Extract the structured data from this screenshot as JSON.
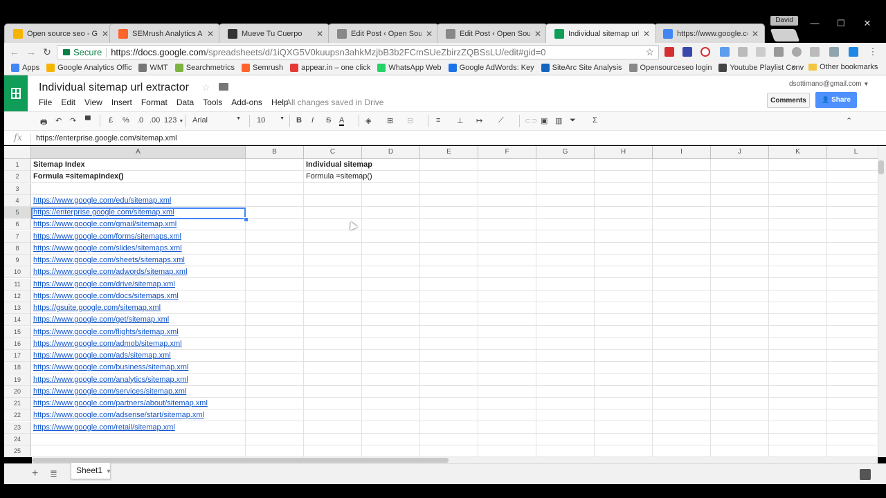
{
  "browser": {
    "tabs": [
      {
        "label": "Open source seo - Goo",
        "favicon": "drive-icon",
        "color": "#f4b400",
        "active": false
      },
      {
        "label": "SEMrush Analytics API |",
        "favicon": "semrush-icon",
        "color": "#ff642d",
        "active": false
      },
      {
        "label": "Mueve Tu Cuerpo",
        "favicon": "spotify-icon",
        "color": "#333333",
        "active": false
      },
      {
        "label": "Edit Post ‹ Open Source",
        "favicon": "page-icon",
        "color": "#888888",
        "active": false
      },
      {
        "label": "Edit Post ‹ Open Source",
        "favicon": "page-icon",
        "color": "#888888",
        "active": false
      },
      {
        "label": "Individual sitemap url e",
        "favicon": "sheets-icon",
        "color": "#0f9d58",
        "active": true
      },
      {
        "label": "https://www.google.co",
        "favicon": "google-icon",
        "color": "#4285f4",
        "active": false
      }
    ],
    "profile_name": "David",
    "address": {
      "secure_label": "Secure",
      "url_host": "https://docs.google.com",
      "url_path": "/spreadsheets/d/1iQXG5V0kuupsn3ahkMzjbB3b2FCmSUeZbirzZQBSsLU/edit#gid=0"
    },
    "bookmarks": [
      {
        "label": "Apps",
        "color": "#4285f4"
      },
      {
        "label": "Google Analytics Offic",
        "color": "#f4b400"
      },
      {
        "label": "WMT",
        "color": "#777777"
      },
      {
        "label": "Searchmetrics",
        "color": "#7cb342"
      },
      {
        "label": "Semrush",
        "color": "#ff642d"
      },
      {
        "label": "appear.in – one click",
        "color": "#e53935"
      },
      {
        "label": "WhatsApp Web",
        "color": "#25d366"
      },
      {
        "label": "Google AdWords: Key",
        "color": "#1a73e8"
      },
      {
        "label": "SiteArc Site Analysis",
        "color": "#1565c0"
      },
      {
        "label": "Opensourceseo login",
        "color": "#888888"
      },
      {
        "label": "Youtube Playlist Conv",
        "color": "#444444"
      }
    ],
    "bookmarks_more": "»",
    "other_bookmarks": "Other bookmarks"
  },
  "sheets": {
    "title": "Individual sitemap url extractor",
    "menu": [
      "File",
      "Edit",
      "View",
      "Insert",
      "Format",
      "Data",
      "Tools",
      "Add-ons",
      "Help"
    ],
    "save_status": "All changes saved in Drive",
    "account": "dsottimano@gmail.com",
    "comments_label": "Comments",
    "share_label": "Share",
    "toolbar": {
      "currency": "£",
      "percent": "%",
      "dec_less": ".0",
      "dec_more": ".00",
      "format_more": "123",
      "font": "Arial",
      "font_size": "10",
      "bold": "B",
      "italic": "I",
      "strike": "S",
      "text_color": "A",
      "functions": "Σ"
    },
    "formula_bar": {
      "fx": "fx",
      "value": "https://enterprise.google.com/sitemap.xml"
    },
    "columns": [
      "A",
      "B",
      "C",
      "D",
      "E",
      "F",
      "G",
      "H",
      "I",
      "J",
      "K",
      "L"
    ],
    "selected_column": "A",
    "selected_row": 5,
    "rows": [
      {
        "n": "1",
        "A": "Sitemap Index",
        "C": "Individual sitemap",
        "style": "bold"
      },
      {
        "n": "2",
        "A": "Formula =sitemapIndex()",
        "C": "Formula =sitemap()",
        "style": "bold"
      },
      {
        "n": "3",
        "A": "",
        "C": ""
      },
      {
        "n": "4",
        "A": "https://www.google.com/edu/sitemap.xml"
      },
      {
        "n": "5",
        "A": "https://enterprise.google.com/sitemap.xml"
      },
      {
        "n": "6",
        "A": "https://www.google.com/gmail/sitemap.xml"
      },
      {
        "n": "7",
        "A": "https://www.google.com/forms/sitemaps.xml"
      },
      {
        "n": "8",
        "A": "https://www.google.com/slides/sitemaps.xml"
      },
      {
        "n": "9",
        "A": "https://www.google.com/sheets/sitemaps.xml"
      },
      {
        "n": "10",
        "A": "https://www.google.com/adwords/sitemap.xml"
      },
      {
        "n": "11",
        "A": "https://www.google.com/drive/sitemap.xml"
      },
      {
        "n": "12",
        "A": "https://www.google.com/docs/sitemaps.xml"
      },
      {
        "n": "13",
        "A": "https://gsuite.google.com/sitemap.xml"
      },
      {
        "n": "14",
        "A": "https://www.google.com/get/sitemap.xml"
      },
      {
        "n": "15",
        "A": "https://www.google.com/flights/sitemap.xml"
      },
      {
        "n": "16",
        "A": "https://www.google.com/admob/sitemap.xml"
      },
      {
        "n": "17",
        "A": "https://www.google.com/ads/sitemap.xml"
      },
      {
        "n": "18",
        "A": "https://www.google.com/business/sitemap.xml"
      },
      {
        "n": "19",
        "A": "https://www.google.com/analytics/sitemap.xml"
      },
      {
        "n": "20",
        "A": "https://www.google.com/services/sitemap.xml"
      },
      {
        "n": "21",
        "A": "https://www.google.com/partners/about/sitemap.xml"
      },
      {
        "n": "22",
        "A": "https://www.google.com/adsense/start/sitemap.xml"
      },
      {
        "n": "23",
        "A": "https://www.google.com/retail/sitemap.xml"
      },
      {
        "n": "24",
        "A": ""
      },
      {
        "n": "25",
        "A": ""
      }
    ],
    "sheet_tabs": [
      {
        "label": "Sheet1",
        "active": true
      }
    ]
  },
  "colors": {
    "sheets_green": "#0f9d58",
    "share_blue": "#4d90fe",
    "link_blue": "#1155cc",
    "selection_blue": "#4285f4"
  }
}
